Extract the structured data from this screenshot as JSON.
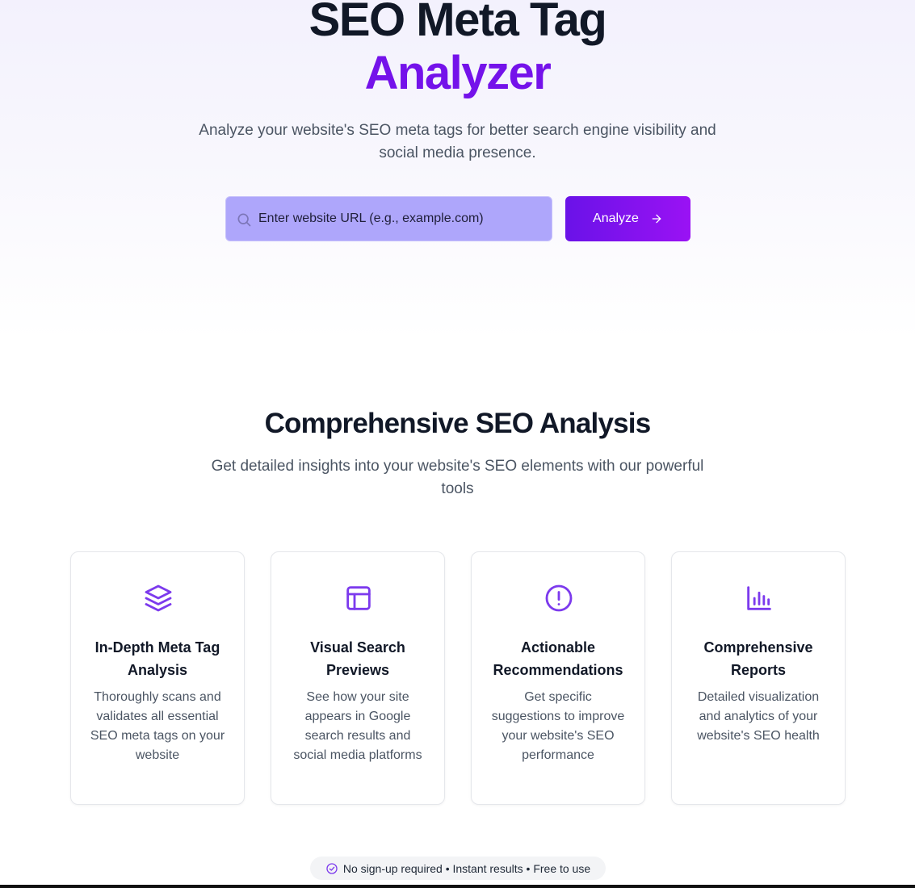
{
  "hero": {
    "title_line1": "SEO Meta Tag",
    "title_line2": "Analyzer",
    "subtitle": "Analyze your website's SEO meta tags for better search engine visibility and social media presence."
  },
  "search": {
    "placeholder": "Enter website URL (e.g., example.com)",
    "value": "",
    "button_label": "Analyze"
  },
  "features": {
    "title": "Comprehensive SEO Analysis",
    "subtitle": "Get detailed insights into your website's SEO elements with our powerful tools",
    "cards": [
      {
        "icon": "layers-icon",
        "title": "In-Depth Meta Tag Analysis",
        "description": "Thoroughly scans and validates all essential SEO meta tags on your website"
      },
      {
        "icon": "layout-icon",
        "title": "Visual Search Previews",
        "description": "See how your site appears in Google search results and social media platforms"
      },
      {
        "icon": "alert-circle-icon",
        "title": "Actionable Recommendations",
        "description": "Get specific suggestions to improve your website's SEO performance"
      },
      {
        "icon": "bar-chart-icon",
        "title": "Comprehensive Reports",
        "description": "Detailed visualization and analytics of your website's SEO health"
      }
    ]
  },
  "badge": {
    "icon": "check-circle-icon",
    "text": "No sign-up required • Instant results • Free to use"
  },
  "colors": {
    "accent": "#7412ea",
    "button_gradient_start": "#6a12e8",
    "button_gradient_end": "#9a12f4",
    "input_bg": "#aea6fb"
  }
}
